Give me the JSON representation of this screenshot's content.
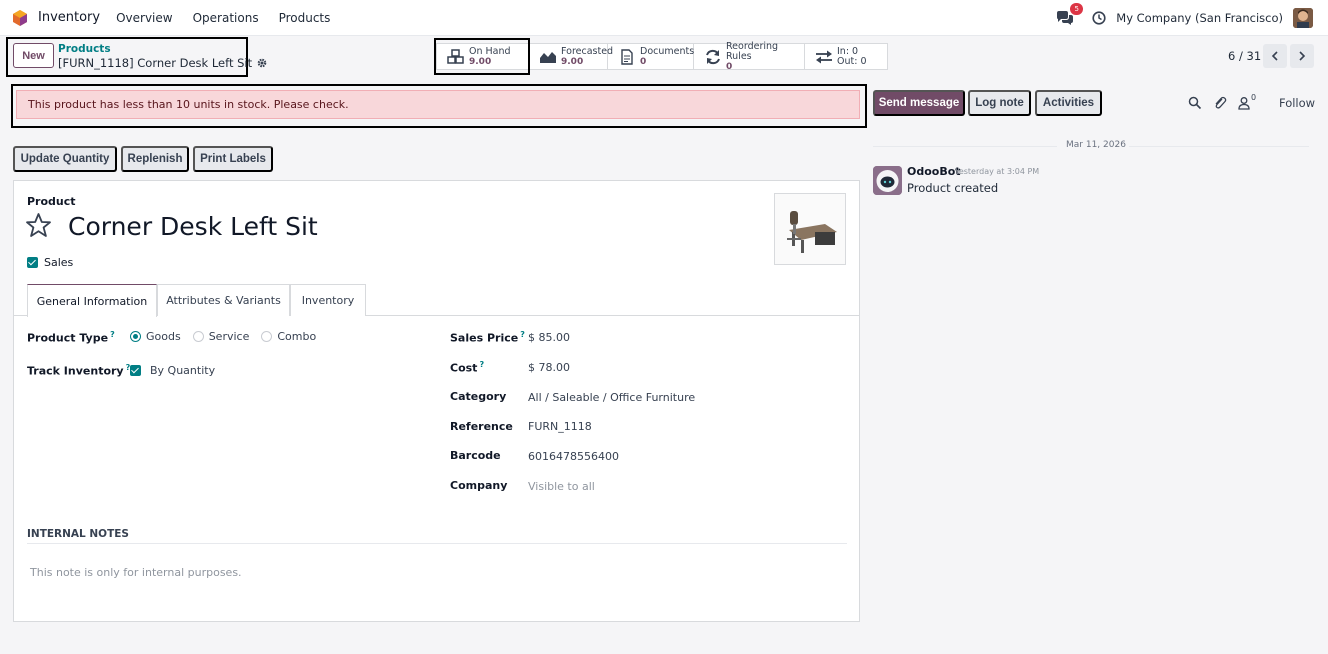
{
  "navbar": {
    "app_name": "Inventory",
    "menu": [
      "Overview",
      "Operations",
      "Products"
    ],
    "message_count": "5",
    "company": "My Company (San Francisco)"
  },
  "control_panel": {
    "new_label": "New",
    "breadcrumb_parent": "Products",
    "record_title": "[FURN_1118] Corner Desk Left Sit",
    "pager": "6 / 31"
  },
  "smart_buttons": [
    {
      "label": "On Hand",
      "value": "9.00",
      "icon": "cubes-icon"
    },
    {
      "label": "Forecasted",
      "value": "9.00",
      "icon": "area-chart-icon"
    },
    {
      "label": "Documents",
      "value": "0",
      "icon": "document-icon"
    },
    {
      "label": "Reordering Rules",
      "value": "0",
      "icon": "refresh-icon"
    },
    {
      "label": "In: 0",
      "value": "Out: 0",
      "icon": "exchange-icon"
    }
  ],
  "alert": "This product has less than 10 units in stock. Please check.",
  "actions": [
    "Update Quantity",
    "Replenish",
    "Print Labels"
  ],
  "form": {
    "product_label": "Product",
    "name": "Corner Desk Left Sit",
    "sales_label": "Sales",
    "tabs": [
      "General Information",
      "Attributes & Variants",
      "Inventory"
    ],
    "product_type_label": "Product Type",
    "product_type_options": [
      "Goods",
      "Service",
      "Combo"
    ],
    "track_inventory_label": "Track Inventory",
    "track_inventory_value": "By Quantity",
    "sales_price_label": "Sales Price",
    "sales_price": "$ 85.00",
    "cost_label": "Cost",
    "cost": "$ 78.00",
    "category_label": "Category",
    "category": "All / Saleable / Office Furniture",
    "reference_label": "Reference",
    "reference": "FURN_1118",
    "barcode_label": "Barcode",
    "barcode": "6016478556400",
    "company_label": "Company",
    "company_placeholder": "Visible to all",
    "internal_notes_title": "INTERNAL NOTES",
    "internal_notes_placeholder": "This note is only for internal purposes."
  },
  "chatter": {
    "send_message": "Send message",
    "log_note": "Log note",
    "activities": "Activities",
    "follower_count": "0",
    "follow": "Follow",
    "date": "Mar 11, 2026",
    "author": "OdooBot",
    "time": "Yesterday at 3:04 PM",
    "message": "Product created"
  },
  "colors": {
    "brand": "#714b67",
    "accent": "#017e84",
    "alert_bg": "#f8d7da"
  }
}
